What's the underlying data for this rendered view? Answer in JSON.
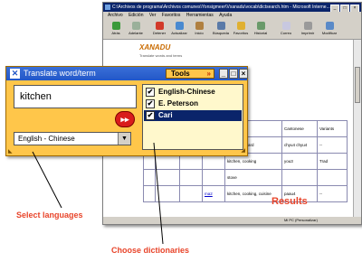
{
  "browser": {
    "title": "C:\\Archivos de programa\\Archivos comunes\\Yonsigmeer\\Vxanadu\\vocab\\dictsearch.htm - Microsoft Interne...",
    "menu": [
      "Archivo",
      "Edición",
      "Ver",
      "Favoritos",
      "Herramientas",
      "Ayuda"
    ],
    "toolbar": [
      "Atrás",
      "Adelante",
      "Detener",
      "Actualizar",
      "Inicio",
      "Búsqueda",
      "Favoritos",
      "Historial",
      "Correo",
      "Imprimir",
      "Modificar"
    ],
    "logo": "XANADU",
    "logo_sub": "Translate words and terms",
    "red_text": "at",
    "table": {
      "header": [
        "",
        "",
        "",
        "",
        "",
        "Cantonese",
        "Variants"
      ],
      "rows": [
        [
          "",
          "",
          "",
          "",
          "sect, cupboard",
          "chyu4\nchyu4",
          "--"
        ],
        [
          "",
          "",
          "",
          "",
          "kitchen, cooking",
          "you3",
          "Trad"
        ],
        [
          "",
          "",
          "",
          "",
          "stove",
          "",
          ""
        ],
        [
          "",
          "",
          "",
          "ma2",
          "kitchen, cooking, cuisine",
          "paau4",
          "--"
        ]
      ]
    },
    "status": "Mi PC (Personalizar)"
  },
  "widget": {
    "title": "Translate word/term",
    "tools_label": "Tools",
    "search_value": "kitchen",
    "language": "English - Chinese",
    "go_symbol": "▸▸",
    "dictionaries": [
      {
        "label": "English-Chinese",
        "checked": "✔"
      },
      {
        "label": "E. Peterson",
        "checked": "✔"
      },
      {
        "label": "Cari",
        "checked": "✔"
      }
    ]
  },
  "callouts": {
    "select_languages": "Select languages",
    "choose_dictionaries": "Choose dictionaries",
    "results": "Results"
  },
  "colors": {
    "widget_bg": "#ffc64a",
    "titlebar": "#2257c7",
    "callout": "#e8442a",
    "selection": "#0a246a"
  }
}
